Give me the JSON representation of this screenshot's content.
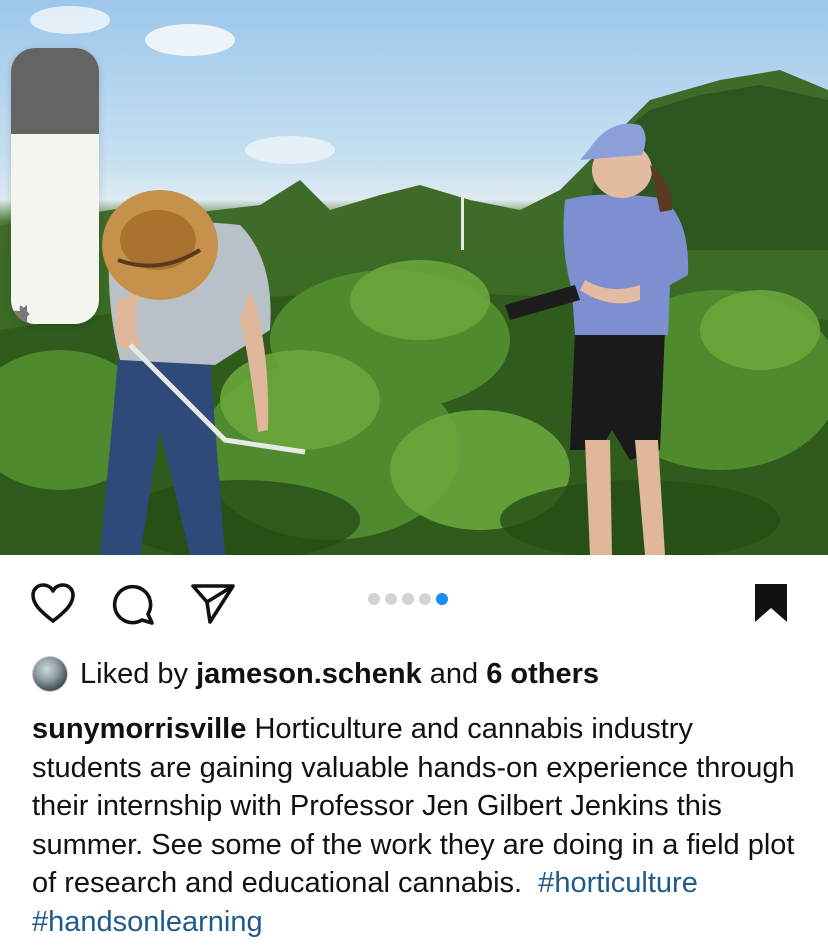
{
  "post": {
    "liked_by_prefix": "Liked by",
    "liked_by_user": "jameson.schenk",
    "liked_by_and": "and",
    "liked_by_others": "6 others",
    "caption_username": "sunymorrisville",
    "caption_text": "Horticulture and cannabis industry students are gaining valuable hands-on experience through their internship with Professor Jen Gilbert Jenkins this summer. See some of the work they are doing in a field plot of research and educational cannabis.",
    "hashtags": [
      "#horticulture",
      "#handsonlearning"
    ]
  },
  "carousel": {
    "total": 5,
    "active_index": 4
  },
  "volume_hud": {
    "level": 0.69,
    "icons": [
      "speaker-icon",
      "bluetooth-icon"
    ]
  },
  "icons": {
    "like": "heart-icon",
    "comment": "comment-icon",
    "share": "send-icon",
    "save": "bookmark-icon"
  },
  "colors": {
    "active_dot": "#1a8ef0",
    "inactive_dot": "#d3d3d3",
    "hashtag": "#1f5a8c"
  }
}
